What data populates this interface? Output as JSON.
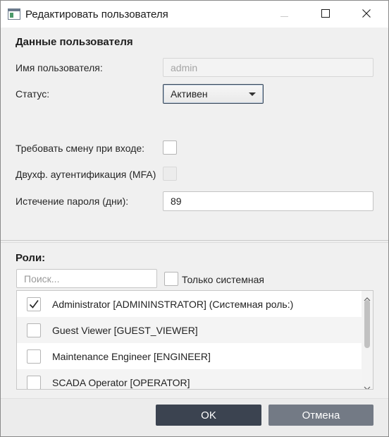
{
  "window": {
    "title": "Редактировать пользователя"
  },
  "user_section": {
    "heading": "Данные пользователя",
    "username_label": "Имя пользователя:",
    "username_value": "admin",
    "status_label": "Статус:",
    "status_value": "Активен",
    "require_change_label": "Требовать смену при входе:",
    "require_change_checked": false,
    "mfa_label": "Двухф. аутентификация (MFA)",
    "mfa_checked": false,
    "expiry_label": "Истечение пароля (дни):",
    "expiry_value": "89"
  },
  "roles_section": {
    "heading": "Роли:",
    "search_placeholder": "Поиск...",
    "system_only_label": "Только системная",
    "roles": [
      {
        "label": "Administrator [ADMININSTRATOR] (Системная роль:)",
        "checked": true
      },
      {
        "label": "Guest Viewer [GUEST_VIEWER]",
        "checked": false
      },
      {
        "label": "Maintenance Engineer [ENGINEER]",
        "checked": false
      },
      {
        "label": "SCADA Operator [OPERATOR]",
        "checked": false
      }
    ]
  },
  "footer": {
    "ok_label": "OK",
    "cancel_label": "Отмена"
  },
  "colors": {
    "ok_button": "#3b4350",
    "cancel_button": "#737a85",
    "status_border": "#3c4a5a"
  },
  "icons": {
    "app": "app-window-icon",
    "minimize": "minimize-icon",
    "maximize": "maximize-icon",
    "close": "close-icon",
    "check": "check-icon",
    "dropdown": "chevron-down-icon"
  }
}
